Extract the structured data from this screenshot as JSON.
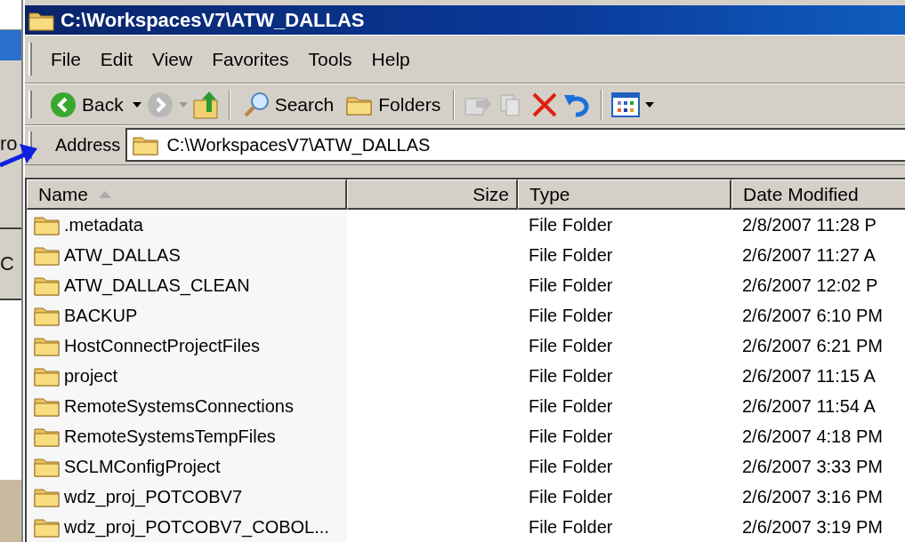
{
  "window": {
    "title": "C:\\WorkspacesV7\\ATW_DALLAS"
  },
  "background_fragments": [
    "ro",
    "C"
  ],
  "menu": [
    "File",
    "Edit",
    "View",
    "Favorites",
    "Tools",
    "Help"
  ],
  "toolbar": {
    "back": "Back",
    "search": "Search",
    "folders": "Folders"
  },
  "address": {
    "label": "Address",
    "value": "C:\\WorkspacesV7\\ATW_DALLAS"
  },
  "columns": [
    {
      "label": "Name",
      "sorted": true
    },
    {
      "label": "Size",
      "sorted": false
    },
    {
      "label": "Type",
      "sorted": false
    },
    {
      "label": "Date Modified",
      "sorted": false
    }
  ],
  "rows": [
    {
      "name": ".metadata",
      "type": "File Folder",
      "date": "2/8/2007 11:28 P"
    },
    {
      "name": "ATW_DALLAS",
      "type": "File Folder",
      "date": "2/6/2007 11:27 A"
    },
    {
      "name": "ATW_DALLAS_CLEAN",
      "type": "File Folder",
      "date": "2/6/2007 12:02 P"
    },
    {
      "name": "BACKUP",
      "type": "File Folder",
      "date": "2/6/2007 6:10 PM"
    },
    {
      "name": "HostConnectProjectFiles",
      "type": "File Folder",
      "date": "2/6/2007 6:21 PM"
    },
    {
      "name": "project",
      "type": "File Folder",
      "date": "2/6/2007 11:15 A"
    },
    {
      "name": "RemoteSystemsConnections",
      "type": "File Folder",
      "date": "2/6/2007 11:54 A"
    },
    {
      "name": "RemoteSystemsTempFiles",
      "type": "File Folder",
      "date": "2/6/2007 4:18 PM"
    },
    {
      "name": "SCLMConfigProject",
      "type": "File Folder",
      "date": "2/6/2007 3:33 PM"
    },
    {
      "name": "wdz_proj_POTCOBV7",
      "type": "File Folder",
      "date": "2/6/2007 3:16 PM"
    },
    {
      "name": "wdz_proj_POTCOBV7_COBOL...",
      "type": "File Folder",
      "date": "2/6/2007 3:19 PM"
    }
  ]
}
